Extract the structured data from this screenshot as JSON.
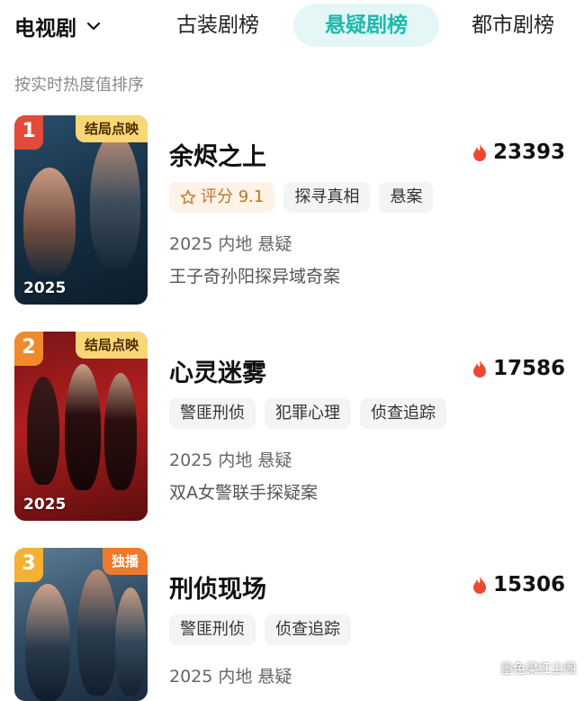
{
  "header": {
    "category": "电视剧",
    "tabs": [
      {
        "label": "古装剧榜",
        "active": false
      },
      {
        "label": "悬疑剧榜",
        "active": true
      },
      {
        "label": "都市剧榜",
        "active": false
      }
    ],
    "accent_color": "#1fb8ae"
  },
  "subtitle": "按实时热度值排序",
  "items": [
    {
      "rank": "1",
      "rank_color": "#e24a3b",
      "flag": "结局点映",
      "poster_year": "2025",
      "title": "余烬之上",
      "heat": "23393",
      "rating_label": "评分 9.1",
      "tags": [
        "探寻真相",
        "悬案"
      ],
      "meta": "2025 内地 悬疑",
      "desc": "王子奇孙阳探异域奇案"
    },
    {
      "rank": "2",
      "rank_color": "#f08a2c",
      "flag": "结局点映",
      "poster_year": "2025",
      "title": "心灵迷雾",
      "heat": "17586",
      "tags": [
        "警匪刑侦",
        "犯罪心理",
        "侦查追踪"
      ],
      "meta": "2025 内地 悬疑",
      "desc": "双A女警联手探疑案"
    },
    {
      "rank": "3",
      "rank_color": "#f3b233",
      "flag": "独播",
      "title": "刑侦现场",
      "heat": "15306",
      "tags": [
        "警匪刑侦",
        "侦查追踪"
      ],
      "meta": "2025 内地 悬疑"
    }
  ],
  "watermark": "墨色梁红尘阁"
}
